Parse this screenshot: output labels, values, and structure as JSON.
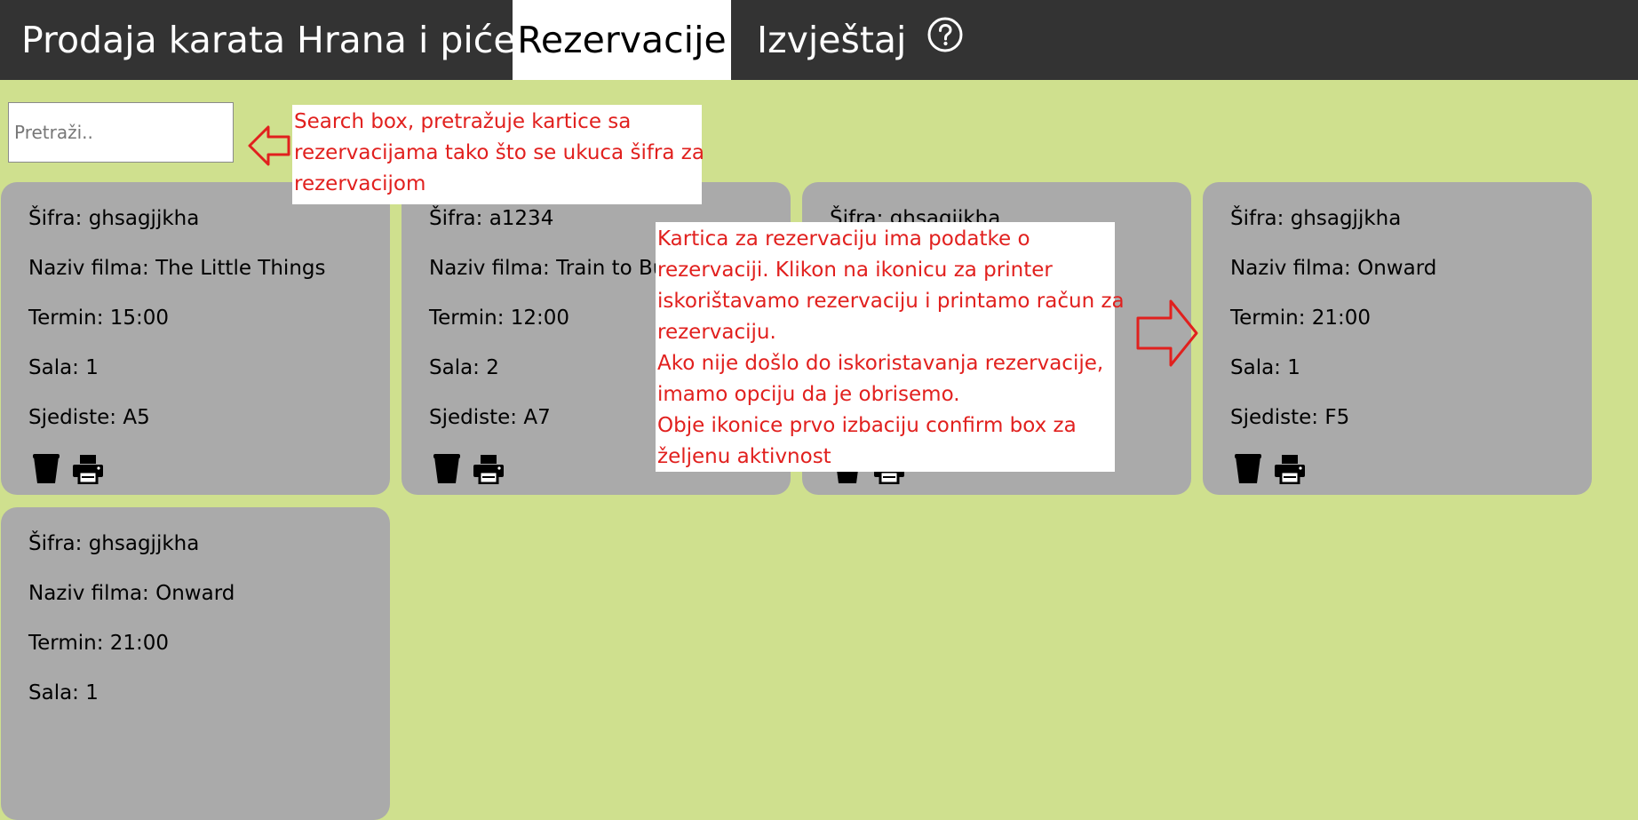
{
  "nav": {
    "tabs": [
      {
        "label": "Prodaja karata"
      },
      {
        "label": "Hrana i piće"
      },
      {
        "label": "Rezervacije",
        "active": true
      },
      {
        "label": "Izvještaj"
      }
    ],
    "help_icon": "question-circle-icon"
  },
  "search": {
    "placeholder": "Pretraži.."
  },
  "reservations": [
    {
      "code": "Šifra: ghsagjjkha",
      "movie": "Naziv filma: The Little Things",
      "time": "Termin: 15:00",
      "hall": "Sala: 1",
      "seat": "Sjediste: A5"
    },
    {
      "code": "Šifra: a1234",
      "movie": "Naziv filma: Train to Busan",
      "time": "Termin: 12:00",
      "hall": "Sala: 2",
      "seat": "Sjediste: A7"
    },
    {
      "code": "Šifra: ghsagjjkha",
      "movie": "",
      "time": "",
      "hall": "",
      "seat": ""
    },
    {
      "code": "Šifra: ghsagjjkha",
      "movie": "Naziv filma: Onward",
      "time": "Termin: 21:00",
      "hall": "Sala: 1",
      "seat": "Sjediste: F5"
    },
    {
      "code": "Šifra: ghsagjjkha",
      "movie": "Naziv filma: Onward",
      "time": "Termin: 21:00",
      "hall": "Sala: 1",
      "seat": ""
    }
  ],
  "card_icons": [
    "trash-icon",
    "printer-icon"
  ],
  "annotations": {
    "search_note": [
      "Search box, pretražuje kartice sa",
      "rezervacijama tako što se ukuca šifra za",
      "rezervacijom"
    ],
    "card_note": [
      "Kartica za rezervaciju ima podatke o",
      "rezervaciji. Klikon na ikonicu za printer",
      "iskorištavamo rezervaciju i printamo račun za",
      "rezervaciju.",
      "Ako nije došlo do iskoristavanja rezervacije,",
      "imamo opciju da je obrisemo.",
      "Obje ikonice prvo izbaciju confirm box za",
      "željenu aktivnost"
    ]
  },
  "colors": {
    "background": "#cfe08e",
    "navbar": "#333333",
    "card": "#aaaaaa",
    "annotation_text": "#e1201e"
  }
}
